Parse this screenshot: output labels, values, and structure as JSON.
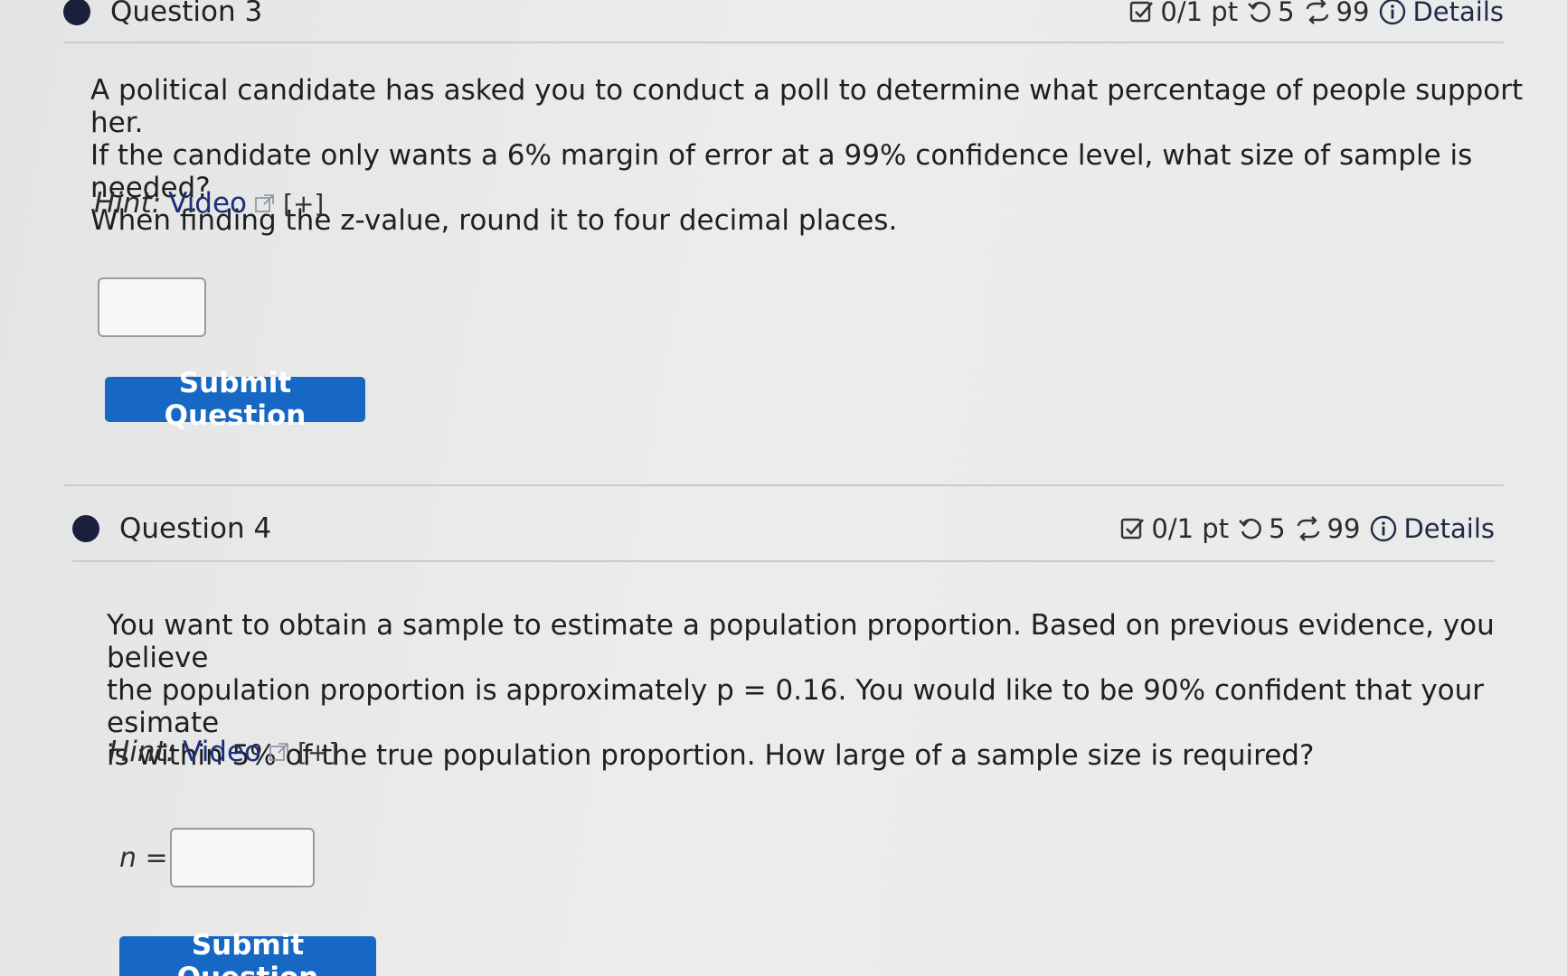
{
  "question3": {
    "title": "Question 3",
    "meta": {
      "points": "0/1 pt",
      "attempts": "5",
      "versions": "99",
      "details_label": "Details"
    },
    "text_lines": [
      "A political candidate has asked you to conduct a poll to determine what percentage of people support her.",
      "If the candidate only wants a 6% margin of error at a 99% confidence level, what size of sample is needed?",
      "When finding the z-value, round it to four decimal places."
    ],
    "hint": {
      "label": "Hint:",
      "video_label": "Video",
      "expand_label": "[+]"
    },
    "answer_value": "",
    "submit_label": "Submit Question"
  },
  "question4": {
    "title": "Question 4",
    "meta": {
      "points": "0/1 pt",
      "attempts": "5",
      "versions": "99",
      "details_label": "Details"
    },
    "text_lines": [
      "You want to obtain a sample to estimate a population proportion. Based on previous evidence, you believe",
      "the population proportion is approximately p = 0.16. You would like to be 90% confident that your esimate",
      "is within 5% of the true population proportion. How large of a sample size is required?"
    ],
    "hint": {
      "label": "Hint:",
      "video_label": "Video",
      "expand_label": "[+]"
    },
    "answer_label": "n =",
    "answer_value": "",
    "submit_label": "Submit Question"
  },
  "colors": {
    "accent_button": "#1768c4",
    "link": "#1b2f7a",
    "bullet": "#1a1f3d"
  },
  "icons": [
    "checkbox-icon",
    "retry-icon",
    "versions-icon",
    "info-icon",
    "external-link-icon"
  ]
}
